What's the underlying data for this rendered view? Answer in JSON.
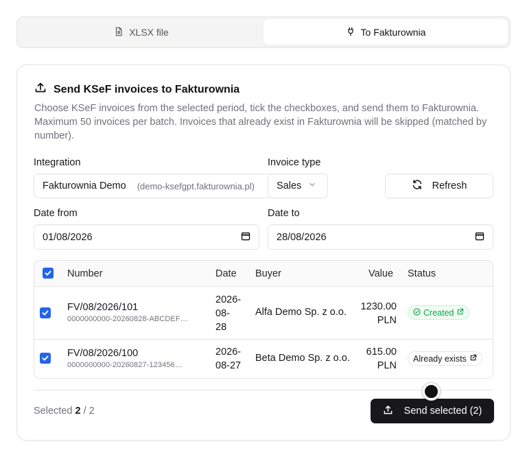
{
  "tabs": [
    {
      "label": "XLSX file",
      "icon": "file-spreadsheet-icon",
      "active": false
    },
    {
      "label": "To Fakturownia",
      "icon": "plug-icon",
      "active": true
    }
  ],
  "card": {
    "title": "Send KSeF invoices to Fakturownia",
    "description": "Choose KSeF invoices from the selected period, tick the checkboxes, and send them to Fakturownia. Maximum 50 invoices per batch. Invoices that already exist in Fakturownia will be skipped (matched by number)."
  },
  "form": {
    "integration_label": "Integration",
    "integration_value": "Fakturownia Demo",
    "integration_sub": "(demo-ksefgpt.fakturownia.pl)",
    "invoice_type_label": "Invoice type",
    "invoice_type_value": "Sales",
    "refresh_label": "Refresh",
    "date_from_label": "Date from",
    "date_from_value": "01/08/2026",
    "date_to_label": "Date to",
    "date_to_value": "28/08/2026"
  },
  "table": {
    "headers": {
      "number": "Number",
      "date": "Date",
      "buyer": "Buyer",
      "value": "Value",
      "status": "Status"
    },
    "rows": [
      {
        "number": "FV/08/2026/101",
        "ksef": "0000000000-20260828-ABCDEF…",
        "date_l1": "2026-",
        "date_l2": "08-",
        "date_l3": "28",
        "buyer": "Alfa Demo Sp. z o.o.",
        "value_amount": "1230.00",
        "value_currency": "PLN",
        "status": "Created",
        "checked": true
      },
      {
        "number": "FV/08/2026/100",
        "ksef": "0000000000-20260827-123456…",
        "date_l1": "2026-",
        "date_l2": "08-27",
        "buyer": "Beta Demo Sp. z o.o.",
        "value_amount": "615.00",
        "value_currency": "PLN",
        "status": "Already exists",
        "checked": true
      }
    ]
  },
  "footer": {
    "selected_prefix": "Selected",
    "selected_count": "2",
    "selected_sep": "/",
    "selected_total": "2",
    "send_label": "Send selected (2)"
  },
  "colors": {
    "accent": "#2563eb",
    "primary_button": "#18181b",
    "created_green": "#16a34a"
  }
}
